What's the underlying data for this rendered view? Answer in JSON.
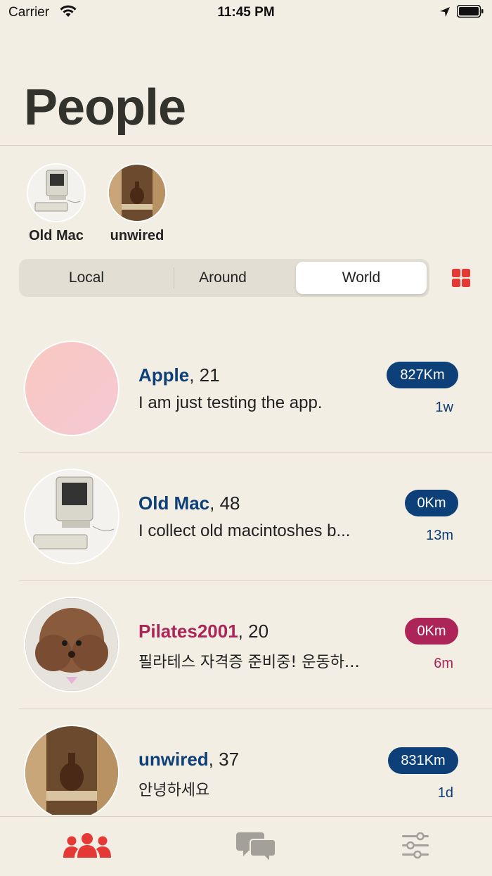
{
  "status": {
    "carrier": "Carrier",
    "time": "11:45 PM"
  },
  "title": "People",
  "stories": [
    {
      "name": "Old Mac"
    },
    {
      "name": "unwired"
    }
  ],
  "segments": {
    "local": "Local",
    "around": "Around",
    "world": "World",
    "selected": "World"
  },
  "people": [
    {
      "name": "Apple",
      "age": ", 21",
      "message": "I am just testing the app.",
      "distance": "827Km",
      "time": "1w",
      "color": "#0d3f78"
    },
    {
      "name": "Old Mac",
      "age": ", 48",
      "message": "I collect old macintoshes b...",
      "distance": "0Km",
      "time": "13m",
      "color": "#0d3f78"
    },
    {
      "name": "Pilates2001",
      "age": ", 20",
      "message": "필라테스 자격증 준비중! 운동하…",
      "distance": "0Km",
      "time": "6m",
      "color": "#ad2558"
    },
    {
      "name": "unwired",
      "age": ", 37",
      "message": "안녕하세요",
      "distance": "831Km",
      "time": "1d",
      "color": "#0d3f78"
    }
  ],
  "tabbar": {
    "active": "people",
    "accent": "#e53935",
    "inactive": "#a3a09a"
  }
}
